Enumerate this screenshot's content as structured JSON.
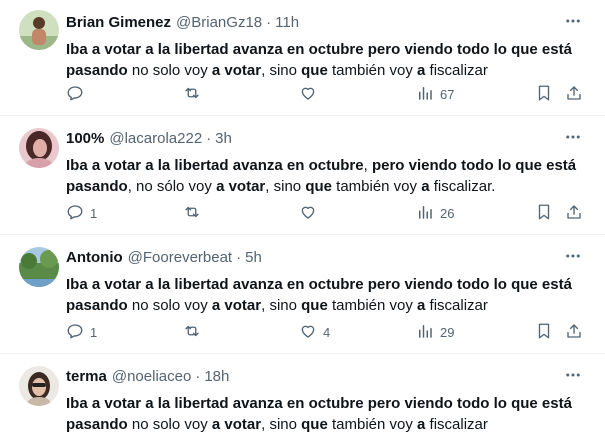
{
  "tweets": [
    {
      "name": "Brian Gimenez",
      "handle": "@BrianGz18",
      "time": "11h",
      "segments": [
        {
          "t": "Iba a votar a la libertad avanza en octubre pero viendo todo lo que está pasando",
          "b": true
        },
        {
          "t": " no solo voy ",
          "b": false
        },
        {
          "t": "a votar",
          "b": true
        },
        {
          "t": ", sino ",
          "b": false
        },
        {
          "t": "que",
          "b": true
        },
        {
          "t": " también voy ",
          "b": false
        },
        {
          "t": "a",
          "b": true
        },
        {
          "t": " fiscalizar",
          "b": false
        }
      ],
      "replies": "",
      "likes": "",
      "views": "67",
      "avatar_colors": [
        "#c8ddb8",
        "#b08060"
      ]
    },
    {
      "name": "100%",
      "handle": "@lacarola222",
      "time": "3h",
      "segments": [
        {
          "t": "Iba a votar a la libertad avanza en octubre",
          "b": true
        },
        {
          "t": ", ",
          "b": false
        },
        {
          "t": "pero viendo todo lo que está pasando",
          "b": true
        },
        {
          "t": ", no sólo voy ",
          "b": false
        },
        {
          "t": "a votar",
          "b": true
        },
        {
          "t": ", sino ",
          "b": false
        },
        {
          "t": "que",
          "b": true
        },
        {
          "t": " también voy ",
          "b": false
        },
        {
          "t": "a",
          "b": true
        },
        {
          "t": " fiscalizar.",
          "b": false
        }
      ],
      "replies": "1",
      "likes": "",
      "views": "26",
      "avatar_colors": [
        "#e8c0c4",
        "#5a3030"
      ]
    },
    {
      "name": "Antonio",
      "handle": "@Fooreverbeat",
      "time": "5h",
      "segments": [
        {
          "t": "Iba a votar a la libertad avanza en octubre pero viendo todo lo que está pasando",
          "b": true
        },
        {
          "t": " no solo voy ",
          "b": false
        },
        {
          "t": "a votar",
          "b": true
        },
        {
          "t": ", sino ",
          "b": false
        },
        {
          "t": "que",
          "b": true
        },
        {
          "t": " también voy ",
          "b": false
        },
        {
          "t": "a",
          "b": true
        },
        {
          "t": " fiscalizar",
          "b": false
        }
      ],
      "replies": "1",
      "likes": "4",
      "views": "29",
      "avatar_colors": [
        "#6a9a58",
        "#a8c8e0"
      ]
    },
    {
      "name": "terma",
      "handle": "@noeliaceo",
      "time": "18h",
      "segments": [
        {
          "t": "Iba a votar a la libertad avanza en octubre pero viendo todo lo que está pasando",
          "b": true
        },
        {
          "t": " no solo voy ",
          "b": false
        },
        {
          "t": "a votar",
          "b": true
        },
        {
          "t": ", sino ",
          "b": false
        },
        {
          "t": "que",
          "b": true
        },
        {
          "t": " también voy ",
          "b": false
        },
        {
          "t": "a",
          "b": true
        },
        {
          "t": " fiscalizar",
          "b": false
        }
      ],
      "replies": "",
      "likes": "",
      "views": "",
      "avatar_colors": [
        "#e8e4e0",
        "#4a3a30"
      ]
    }
  ]
}
